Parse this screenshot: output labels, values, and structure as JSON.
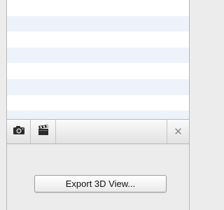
{
  "list": {
    "rows": [
      "",
      "",
      "",
      "",
      "",
      "",
      ""
    ]
  },
  "toolbar": {
    "icons": [
      "camera-icon",
      "clapperboard-icon",
      "close-icon"
    ],
    "close_glyph": "✕"
  },
  "export_button": {
    "label": "Export 3D View..."
  },
  "colors": {
    "row_alt": "#eef3fb",
    "panel_bg": "#ececec",
    "border": "#b8b8b8"
  }
}
